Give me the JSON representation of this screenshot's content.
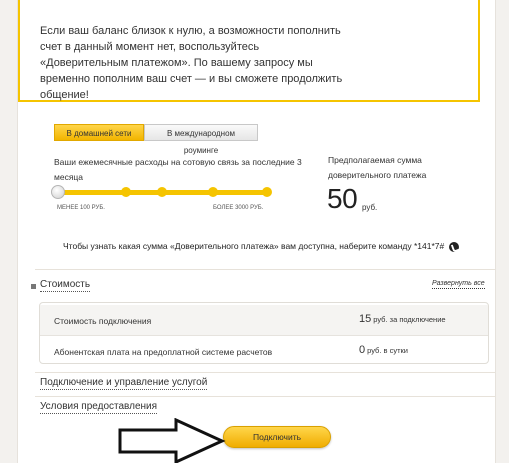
{
  "info": {
    "text": "Если ваш баланс близок к нулю, а возможности пополнить счет в данный момент нет, воспользуйтесь «Доверительным платежом». По вашему запросу мы временно пополним ваш счет — и вы сможете продолжить общение!"
  },
  "tabs": [
    {
      "label": "В домашней сети",
      "active": true
    },
    {
      "label": "В международном роуминге",
      "active": false
    }
  ],
  "calculator": {
    "slider_label": "Ваши ежемесячные расходы на сотовую связь за последние 3 месяца",
    "slider_steps": 5,
    "slider_selected_index": 0,
    "range_min": "МЕНЕЕ 100 РУБ.",
    "range_max": "БОЛЕЕ 3000 РУБ.",
    "payment_label": "Предполагаемая сумма доверительного платежа",
    "payment_amount": "50",
    "payment_unit": "руб.",
    "ussd_text": "Чтобы узнать какая сумма «Доверительного платежа» вам доступна, наберите команду *141*7#",
    "accent_color": "#f5c400"
  },
  "sections": {
    "cost_title": "Стоимость",
    "expand_all": "Развернуть все",
    "cost_rows": [
      {
        "name": "Стоимость подключения",
        "value": "15",
        "unit": "руб. за подключение"
      },
      {
        "name": "Абонентская плата на предоплатной системе расчетов",
        "value": "0",
        "unit": "руб. в сутки"
      }
    ],
    "manage_title": "Подключение и управление услугой",
    "terms_title": "Условия предоставления"
  },
  "actions": {
    "connect_label": "Подключить"
  }
}
